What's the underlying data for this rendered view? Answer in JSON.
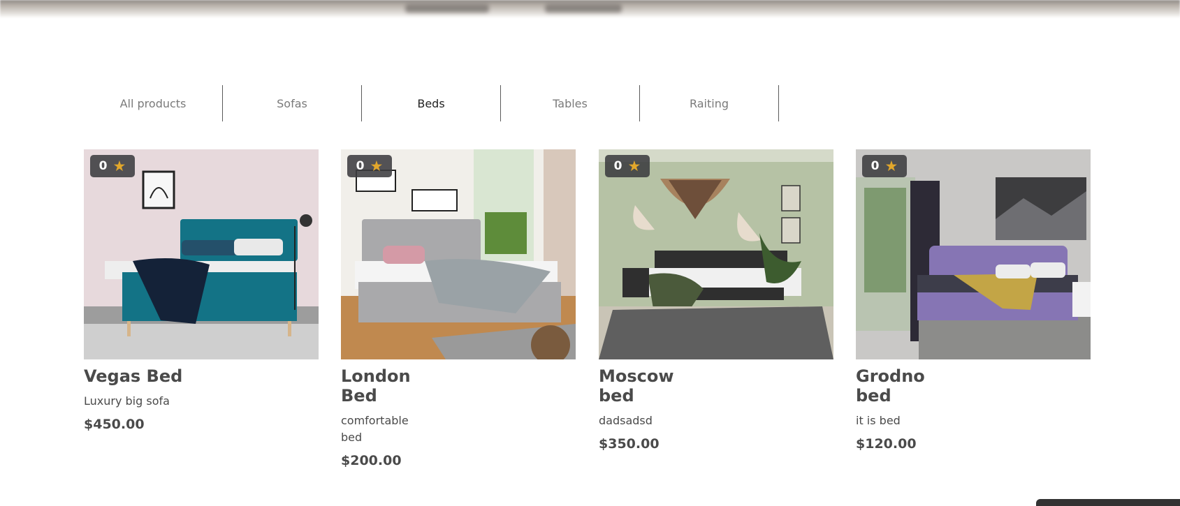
{
  "tabs": [
    {
      "label": "All products"
    },
    {
      "label": "Sofas"
    },
    {
      "label": "Beds"
    },
    {
      "label": "Tables"
    },
    {
      "label": "Raiting"
    }
  ],
  "active_tab": "Beds",
  "products": [
    {
      "name": "Vegas Bed",
      "description": "Luxury big sofa",
      "price": "$450.00",
      "rating": "0"
    },
    {
      "name": "London Bed",
      "description": "comfortable bed",
      "price": "$200.00",
      "rating": "0"
    },
    {
      "name": "Moscow bed",
      "description": "dadsadsd",
      "price": "$350.00",
      "rating": "0"
    },
    {
      "name": "Grodno bed",
      "description": "it is bed",
      "price": "$120.00",
      "rating": "0"
    }
  ],
  "icons": {
    "rating": "star-icon"
  },
  "colors": {
    "star": "#e2a72b",
    "badge": "#3c3c40",
    "text": "#4a4a4a"
  }
}
